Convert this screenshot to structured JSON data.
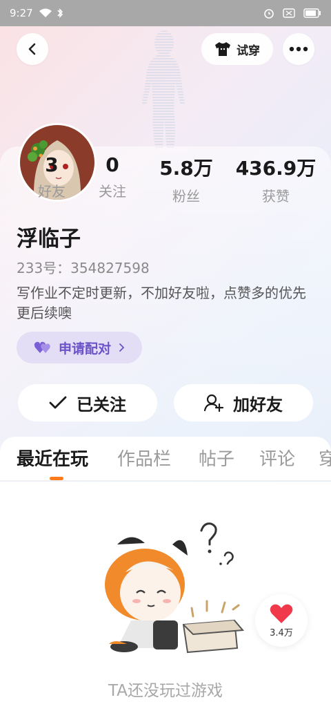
{
  "status_bar": {
    "time": "9:27"
  },
  "header": {
    "try_on_label": "试穿"
  },
  "profile": {
    "name": "浮临子",
    "uid": "233号：354827598",
    "bio": "写作业不定时更新，不加好友啦，点赞多的优先更后续噢",
    "pair_label": "申请配对",
    "stats": [
      {
        "num": "3",
        "label": "好友"
      },
      {
        "num": "0",
        "label": "关注"
      },
      {
        "num": "5.8万",
        "label": "粉丝"
      },
      {
        "num": "436.9万",
        "label": "获赞"
      }
    ]
  },
  "actions": {
    "followed_label": "已关注",
    "add_friend_label": "加好友"
  },
  "tabs": [
    "最近在玩",
    "作品栏",
    "帖子",
    "评论",
    "穿"
  ],
  "content": {
    "empty_text": "TA还没玩过游戏"
  },
  "like_float": {
    "count": "3.4万"
  },
  "colors": {
    "accent": "#ff7a1a",
    "pair_purple": "#6a52c8",
    "like_red": "#f0394a"
  }
}
